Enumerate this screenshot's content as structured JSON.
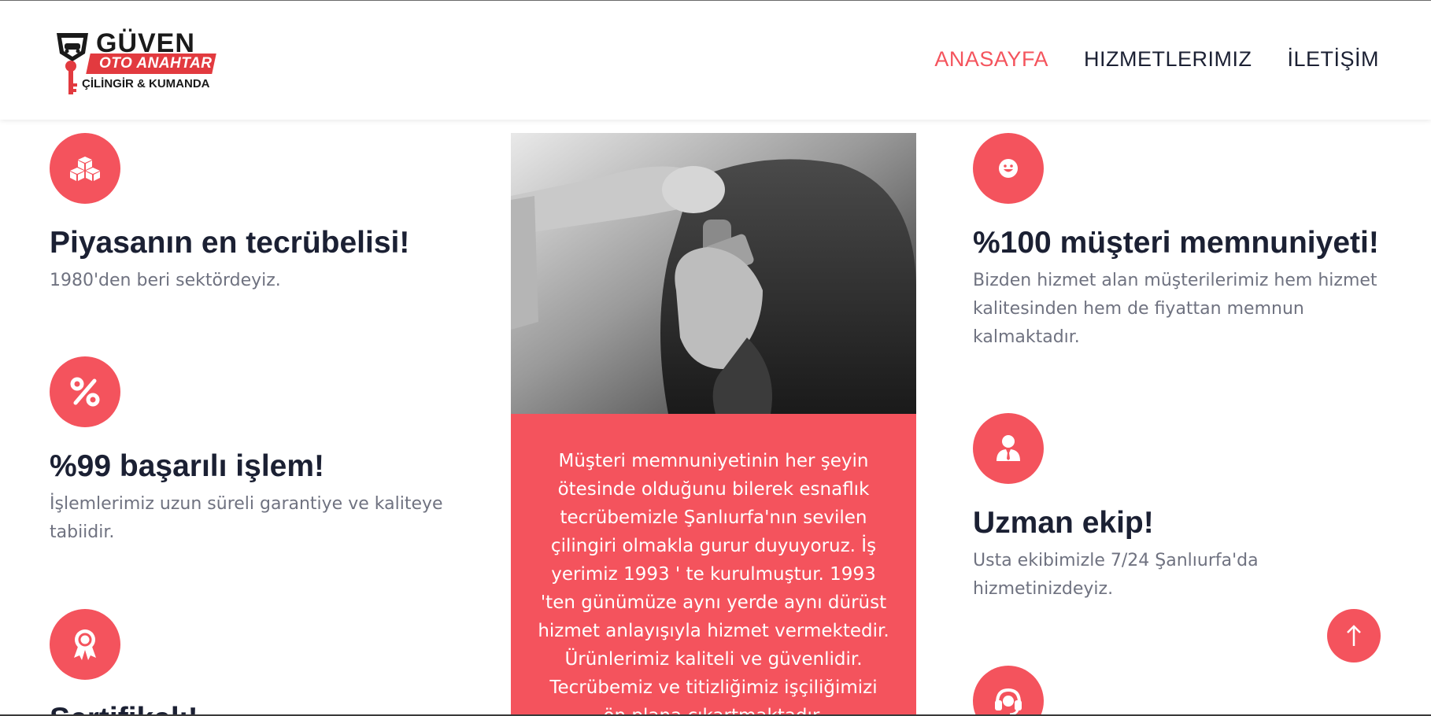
{
  "brand": {
    "name": "GÜVEN",
    "tagline": "OTO ANAHTAR",
    "subtitle": "ÇİLİNGİR & KUMANDA"
  },
  "nav": {
    "items": [
      {
        "label": "ANASAYFA",
        "active": true
      },
      {
        "label": "HIZMETLERIMIZ",
        "active": false
      },
      {
        "label": "İLETİŞİM",
        "active": false
      }
    ]
  },
  "left_features": [
    {
      "icon": "cubes-icon",
      "title": "Piyasanın en tecrübelisi!",
      "text": "1980'den beri sektördeyiz."
    },
    {
      "icon": "percent-icon",
      "title": "%99 başarılı işlem!",
      "text": "İşlemlerimiz uzun süreli garantiye ve kaliteye tabiidir."
    },
    {
      "icon": "award-icon",
      "title": "Sertifikalı!",
      "text": ""
    }
  ],
  "right_features": [
    {
      "icon": "smile-icon",
      "title": "%100 müşteri memnuniyeti!",
      "text": "Bizden hizmet alan müşterilerimiz hem hizmet kalitesinden hem de fiyattan memnun kalmaktadır."
    },
    {
      "icon": "user-tie-icon",
      "title": "Uzman ekip!",
      "text": "Usta ekibimizle 7/24 Şanlıurfa'da hizmetinizdeyiz."
    },
    {
      "icon": "headset-icon",
      "title": "",
      "text": ""
    }
  ],
  "center": {
    "text": "Müşteri memnuniyetinin her şeyin ötesinde olduğunu bilerek esnaflık tecrübemizle Şanlıurfa'nın sevilen çilingiri olmakla gurur duyuyoruz. İş yerimiz 1993 ' te kurulmuştur. 1993 'ten günümüze aynı yerde aynı dürüst hizmet anlayışıyla hizmet vermektedir. Ürünlerimiz kaliteli ve güvenlidir. Tecrübemiz ve titizliğimiz işçiliğimizi ön plana çıkartmaktadır."
  },
  "colors": {
    "accent": "#f4535d",
    "heading": "#1b2033",
    "body": "#6f7280"
  }
}
